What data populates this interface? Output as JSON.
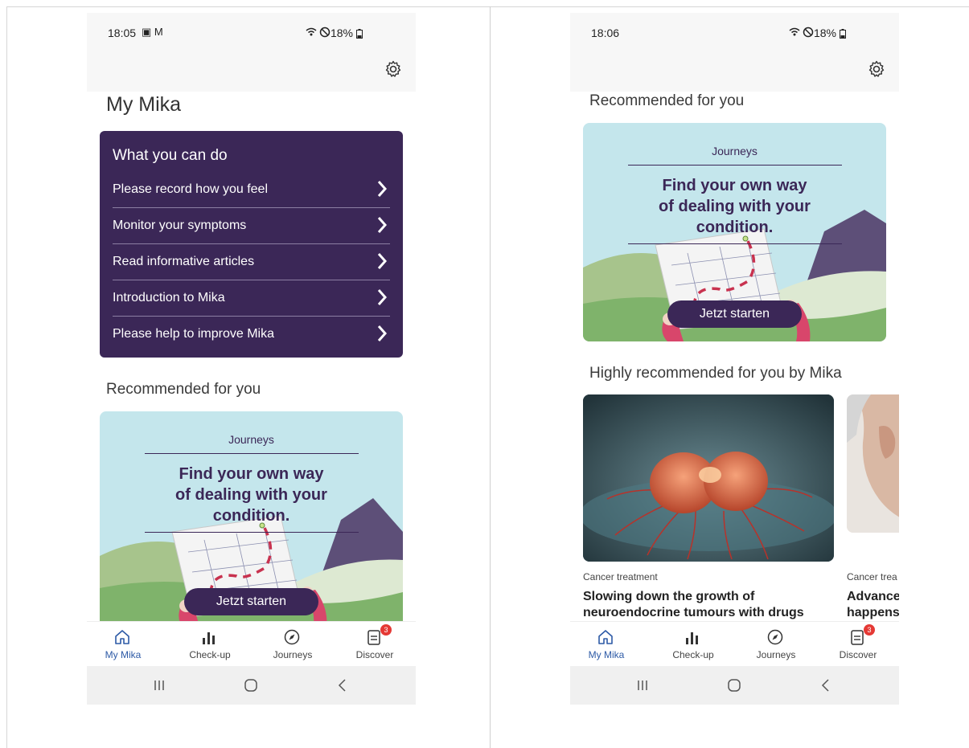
{
  "screens": [
    {
      "status": {
        "time": "18:05",
        "left_icons": "▣ M",
        "battery": "18%"
      },
      "page_title": "My Mika",
      "todo": {
        "heading": "What you can do",
        "items": [
          "Please record how you feel",
          "Monitor your symptoms",
          "Read informative articles",
          "Introduction to Mika",
          "Please help to improve Mika"
        ]
      },
      "recommended_title": "Recommended for you",
      "journey": {
        "category": "Journeys",
        "headline_lines": [
          "Find your own way",
          "of dealing with your",
          "condition."
        ],
        "button": "Jetzt starten"
      }
    },
    {
      "status": {
        "time": "18:06",
        "battery": "18%"
      },
      "recommended_title": "Recommended for you",
      "journey": {
        "category": "Journeys",
        "headline_lines": [
          "Find your own way",
          "of dealing with your",
          "condition."
        ],
        "button": "Jetzt starten"
      },
      "highly_title": "Highly recommended for you by Mika",
      "articles": [
        {
          "category": "Cancer treatment",
          "title_lines": [
            "Slowing down the growth of",
            "neuroendocrine tumours with drugs"
          ]
        },
        {
          "category": "Cancer trea",
          "title_lines": [
            "Advance",
            "happens"
          ]
        }
      ]
    }
  ],
  "tabs": [
    {
      "label": "My Mika",
      "icon": "home-icon",
      "active": true
    },
    {
      "label": "Check-up",
      "icon": "bar-chart-icon",
      "active": false
    },
    {
      "label": "Journeys",
      "icon": "compass-icon",
      "active": false
    },
    {
      "label": "Discover",
      "icon": "document-icon",
      "active": false,
      "badge": "3"
    }
  ],
  "colors": {
    "primary": "#3b2757",
    "active_tab": "#2d5aa6",
    "badge": "#e53935",
    "card_bg": "#c4e6ec"
  }
}
